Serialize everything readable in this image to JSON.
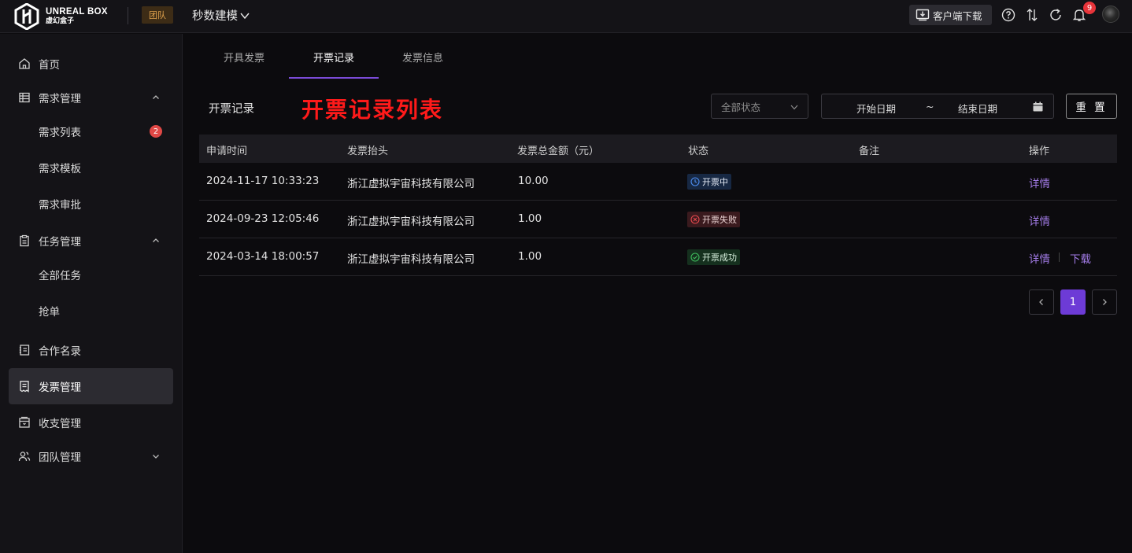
{
  "brand": {
    "name_en": "UNREAL BOX",
    "name_cn": "虚幻盒子"
  },
  "header": {
    "team_badge": "团队",
    "project": "秒数建模",
    "download_label": "客户端下载",
    "notification_count": "9",
    "icons": [
      "help-icon",
      "sort-icon",
      "refresh-icon",
      "bell-icon"
    ]
  },
  "sidebar": {
    "items": [
      {
        "label": "首页",
        "icon": "home-icon"
      },
      {
        "label": "需求管理",
        "icon": "table-icon",
        "expanded": true
      },
      {
        "label": "需求列表",
        "badge": "2"
      },
      {
        "label": "需求模板"
      },
      {
        "label": "需求审批"
      },
      {
        "label": "任务管理",
        "icon": "clipboard-icon",
        "expanded": true
      },
      {
        "label": "全部任务"
      },
      {
        "label": "抢单"
      },
      {
        "label": "合作名录",
        "icon": "contacts-icon"
      },
      {
        "label": "发票管理",
        "icon": "invoice-icon",
        "active": true
      },
      {
        "label": "收支管理",
        "icon": "wallet-icon"
      },
      {
        "label": "团队管理",
        "icon": "team-icon",
        "expanded": false
      }
    ]
  },
  "tabs": [
    {
      "label": "开具发票"
    },
    {
      "label": "开票记录",
      "active": true
    },
    {
      "label": "发票信息"
    }
  ],
  "main": {
    "section_title": "开票记录",
    "overlay_title": "开票记录列表",
    "filters": {
      "status_placeholder": "全部状态",
      "start_date": "开始日期",
      "range_separator": "~",
      "end_date": "结束日期",
      "reset_label": "重 置"
    }
  },
  "table": {
    "columns": [
      "申请时间",
      "发票抬头",
      "发票总金额（元）",
      "状态",
      "备注",
      "操作"
    ],
    "rows": [
      {
        "time": "2024-11-17 10:33:23",
        "title": "浙江虚拟宇宙科技有限公司",
        "amount": "10.00",
        "status": "开票中",
        "status_type": "processing",
        "note": "",
        "actions": [
          "详情"
        ]
      },
      {
        "time": "2024-09-23 12:05:46",
        "title": "浙江虚拟宇宙科技有限公司",
        "amount": "1.00",
        "status": "开票失败",
        "status_type": "failed",
        "note": "",
        "actions": [
          "详情"
        ]
      },
      {
        "time": "2024-03-14 18:00:57",
        "title": "浙江虚拟宇宙科技有限公司",
        "amount": "1.00",
        "status": "开票成功",
        "status_type": "success",
        "note": "",
        "actions": [
          "详情",
          "下载"
        ]
      }
    ]
  },
  "pagination": {
    "current": "1"
  },
  "colors": {
    "accent": "#6d3bd6",
    "link": "#a27be6",
    "badge_red": "#e8343a",
    "highlight_red": "#ff1a1a"
  }
}
